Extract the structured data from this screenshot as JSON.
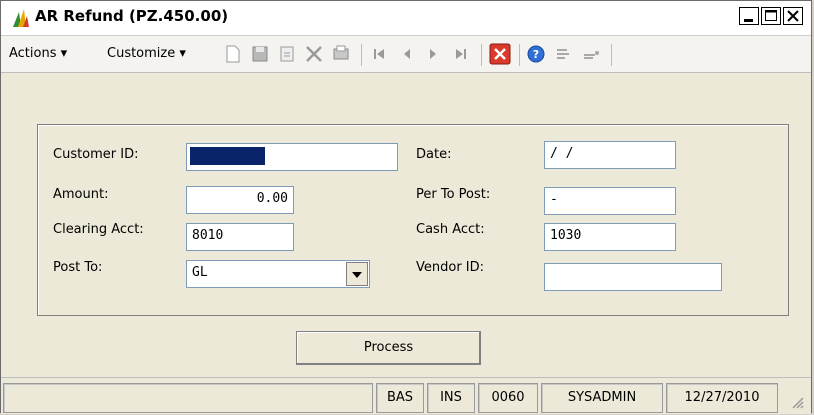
{
  "window": {
    "title": "AR Refund (PZ.450.00)"
  },
  "menu": {
    "actions": "Actions",
    "customize": "Customize"
  },
  "toolbar": {
    "icons": [
      "new-icon",
      "save-icon",
      "copy-icon",
      "delete-icon",
      "print-icon",
      "first-icon",
      "prev-icon",
      "next-icon",
      "last-icon",
      "close-icon",
      "help-icon",
      "note-icon",
      "attach-icon"
    ]
  },
  "form": {
    "customer_id_label": "Customer ID:",
    "customer_id_value": "",
    "amount_label": "Amount:",
    "amount_value": "0.00",
    "clearing_acct_label": "Clearing Acct:",
    "clearing_acct_value": "8010",
    "post_to_label": "Post To:",
    "post_to_value": "GL",
    "date_label": "Date:",
    "date_value": "/ /",
    "per_to_post_label": "Per To Post:",
    "per_to_post_value": "-",
    "cash_acct_label": "Cash Acct:",
    "cash_acct_value": "1030",
    "vendor_id_label": "Vendor ID:",
    "vendor_id_value": ""
  },
  "process_button": {
    "label": "Process"
  },
  "status": {
    "mode": "BAS",
    "insert": "INS",
    "company": "0060",
    "user": "SYSADMIN",
    "date": "12/27/2010"
  },
  "colors": {
    "selection": "#0a246a",
    "delete": "#cc3333",
    "close": "#d93a2b",
    "help": "#2f6fd6"
  }
}
